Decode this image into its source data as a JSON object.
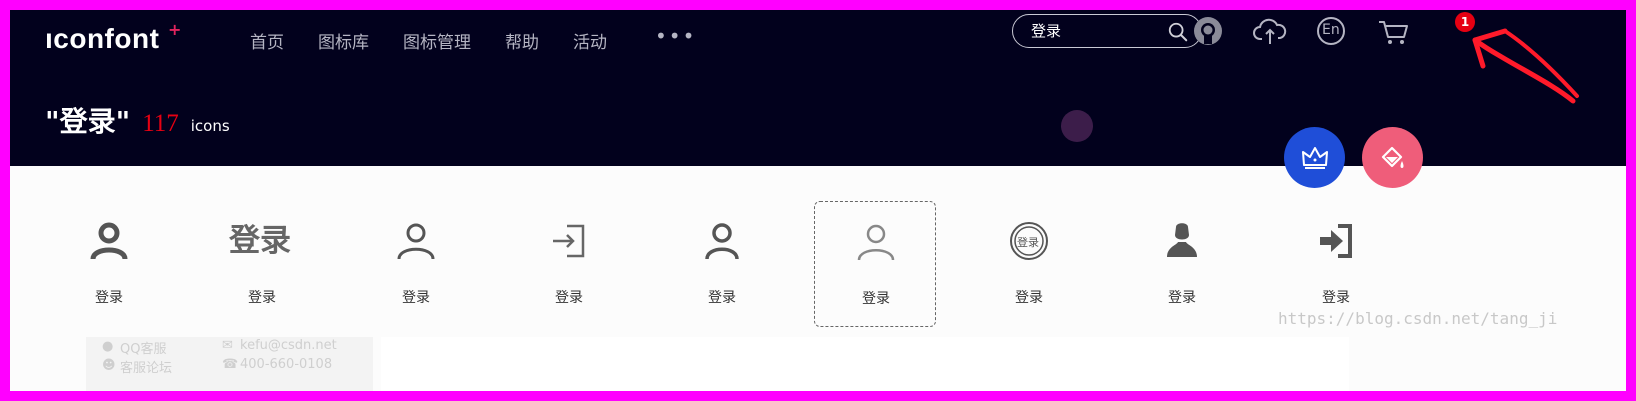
{
  "header": {
    "logo": "ıconfont",
    "logo_mark": "+",
    "nav": [
      "首页",
      "图标库",
      "图标管理",
      "帮助",
      "活动"
    ],
    "more": "•••",
    "search": {
      "value": "登录",
      "icon": "search-icon"
    },
    "icons": [
      "github-icon",
      "upload-cloud-icon",
      "language-en-icon",
      "cart-icon"
    ],
    "language_label": "En",
    "cart_count": "1"
  },
  "result": {
    "query": "\"登录\"",
    "count": "117",
    "unit": "icons"
  },
  "actions": [
    "crown-icon",
    "paint-bucket-icon"
  ],
  "icons": [
    {
      "label": "登录",
      "icon": "user-bold-icon"
    },
    {
      "label": "登录",
      "icon": "text-login-icon",
      "glyph_text": "登录"
    },
    {
      "label": "登录",
      "icon": "user-outline-icon"
    },
    {
      "label": "登录",
      "icon": "sign-in-outline-icon"
    },
    {
      "label": "登录",
      "icon": "user-outline-icon"
    },
    {
      "label": "登录",
      "icon": "user-thin-icon"
    },
    {
      "label": "登录",
      "icon": "login-stamp-icon",
      "glyph_text": "登录"
    },
    {
      "label": "登录",
      "icon": "user-silhouette-icon"
    },
    {
      "label": "登录",
      "icon": "sign-in-solid-icon"
    }
  ],
  "footer": {
    "qq": "QQ客服",
    "forum": "客服论坛",
    "email": "kefu@csdn.net",
    "phone": "400-660-0108"
  },
  "watermark": "https://blog.csdn.net/tang_ji",
  "colors": {
    "header_bg": "#02011d",
    "accent_red": "#e60012",
    "crown_blue": "#1f4ed8",
    "paint_pink": "#ef5d7a",
    "annotation": "#ff1a2a"
  }
}
